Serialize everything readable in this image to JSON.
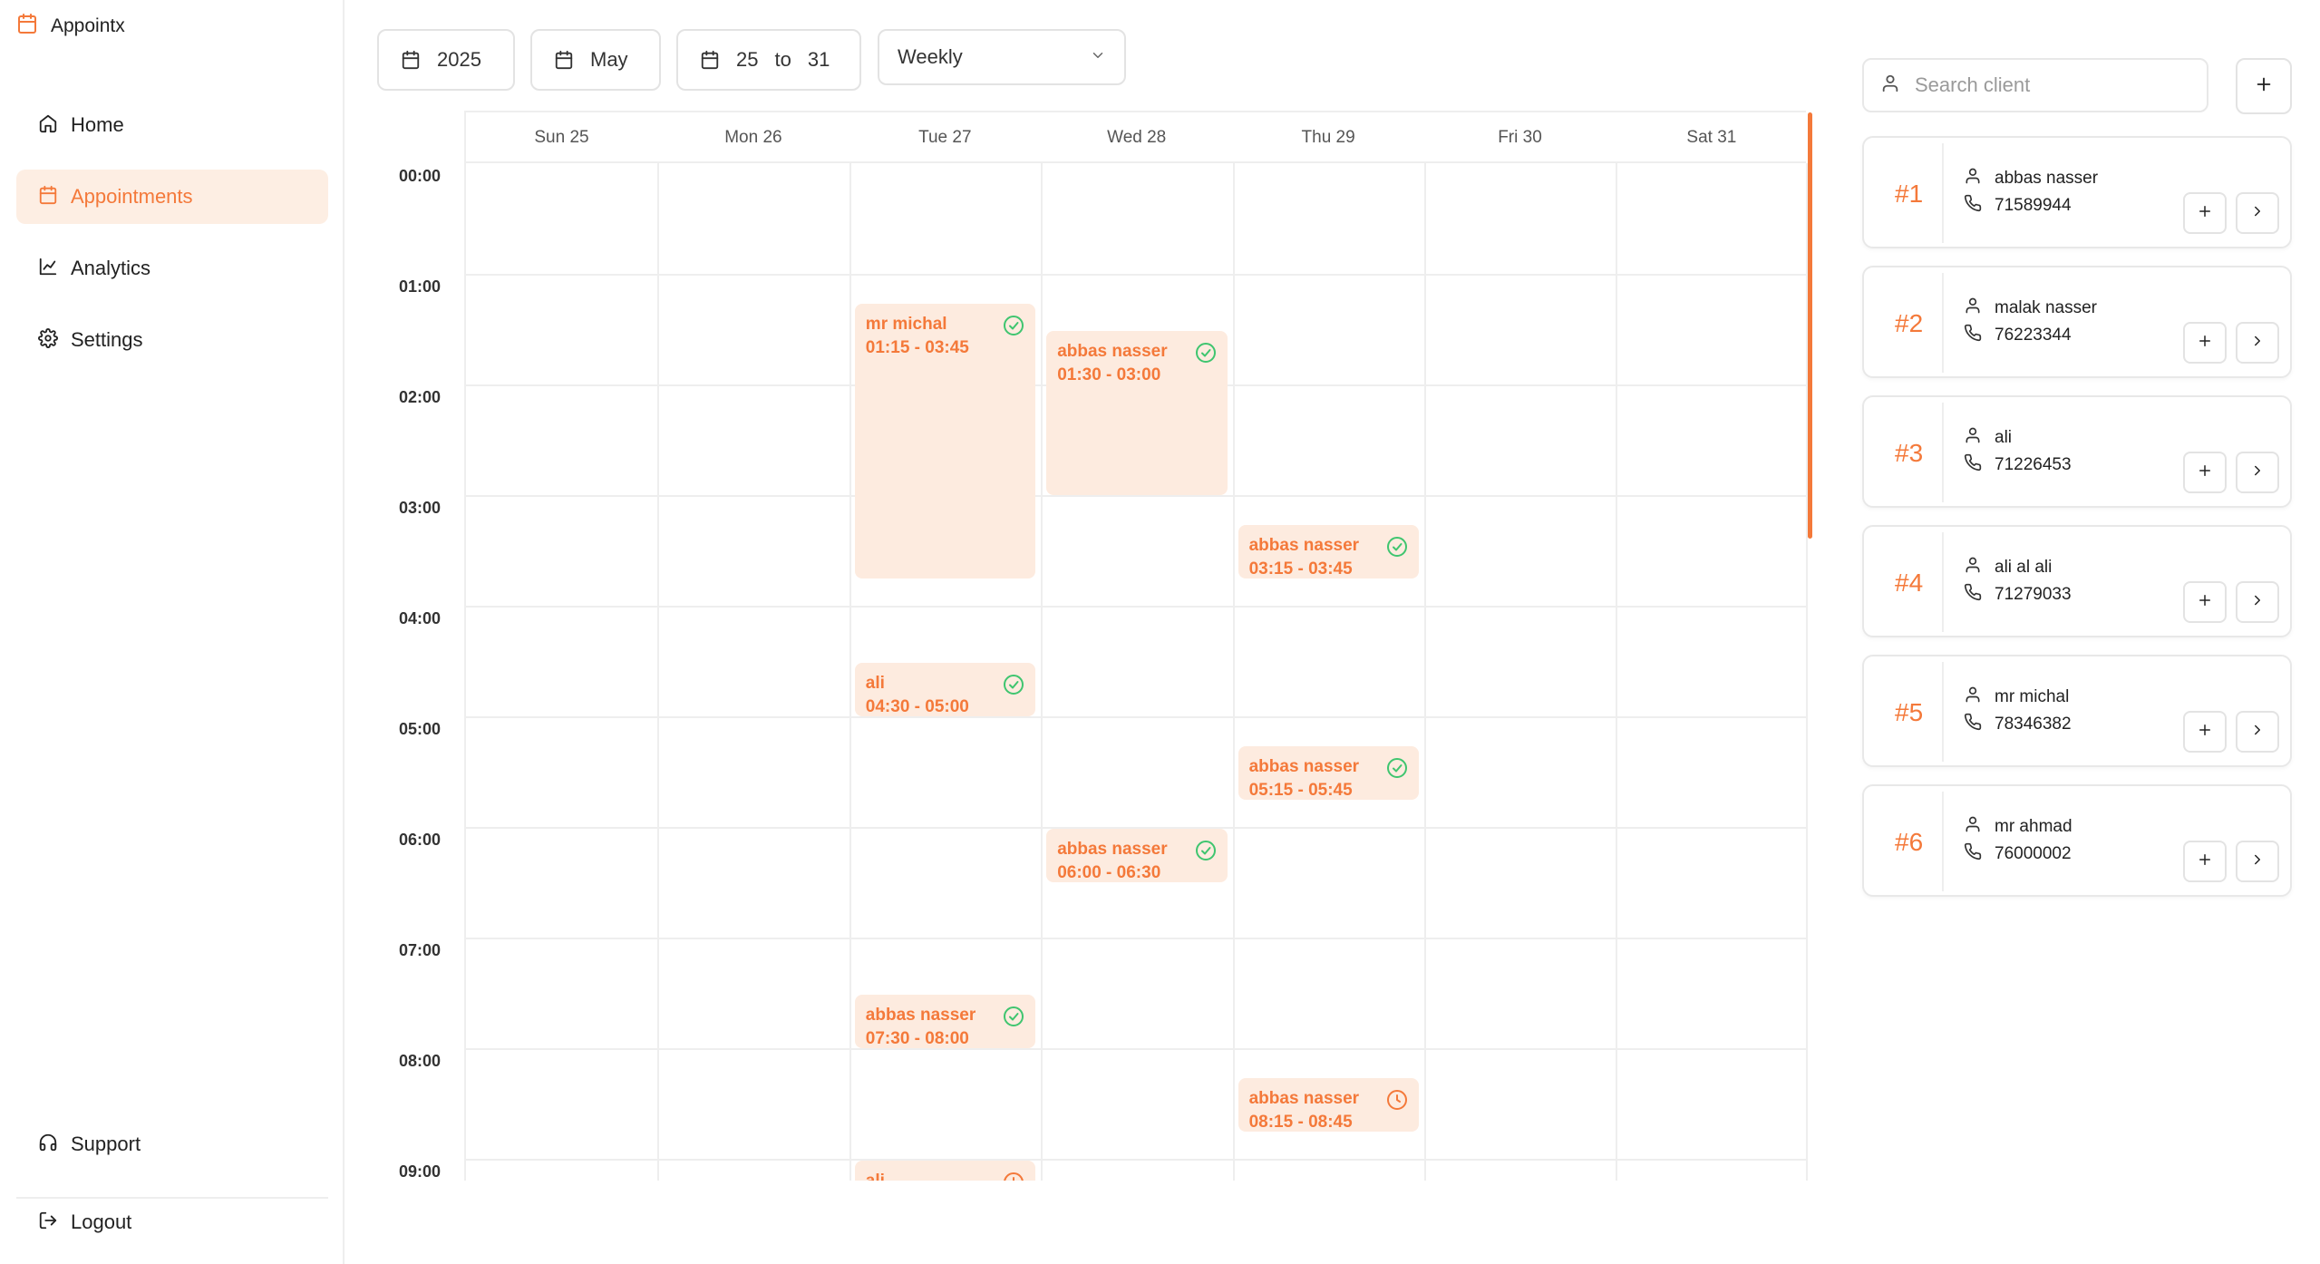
{
  "app": {
    "name": "Appointx"
  },
  "nav": {
    "home": "Home",
    "appointments": "Appointments",
    "analytics": "Analytics",
    "settings": "Settings",
    "support": "Support",
    "logout": "Logout"
  },
  "controls": {
    "year": "2025",
    "month": "May",
    "range_start": "25",
    "range_to": "to",
    "range_end": "31",
    "view": "Weekly"
  },
  "calendar": {
    "days": [
      "Sun 25",
      "Mon 26",
      "Tue 27",
      "Wed 28",
      "Thu 29",
      "Fri 30",
      "Sat 31"
    ],
    "hours": [
      "00:00",
      "01:00",
      "02:00",
      "03:00",
      "04:00",
      "05:00",
      "06:00",
      "07:00",
      "08:00",
      "09:00"
    ],
    "appointments": [
      {
        "day": 2,
        "name": "mr michal",
        "time": "01:15 - 03:45",
        "start": 1.25,
        "end": 3.75,
        "status": "done"
      },
      {
        "day": 3,
        "name": "abbas nasser",
        "time": "01:30 - 03:00",
        "start": 1.5,
        "end": 3.0,
        "status": "done"
      },
      {
        "day": 4,
        "name": "abbas nasser",
        "time": "03:15 - 03:45",
        "start": 3.25,
        "end": 3.75,
        "status": "done"
      },
      {
        "day": 2,
        "name": "ali",
        "time": "04:30 - 05:00",
        "start": 4.5,
        "end": 5.0,
        "status": "done"
      },
      {
        "day": 4,
        "name": "abbas nasser",
        "time": "05:15 - 05:45",
        "start": 5.25,
        "end": 5.75,
        "status": "done"
      },
      {
        "day": 3,
        "name": "abbas nasser",
        "time": "06:00 - 06:30",
        "start": 6.0,
        "end": 6.5,
        "status": "done"
      },
      {
        "day": 2,
        "name": "abbas nasser",
        "time": "07:30 - 08:00",
        "start": 7.5,
        "end": 8.0,
        "status": "done"
      },
      {
        "day": 4,
        "name": "abbas nasser",
        "time": "08:15 - 08:45",
        "start": 8.25,
        "end": 8.75,
        "status": "pending"
      },
      {
        "day": 2,
        "name": "ali",
        "time": "",
        "start": 9.0,
        "end": 9.5,
        "status": "pending"
      }
    ]
  },
  "search": {
    "placeholder": "Search client"
  },
  "clients": [
    {
      "num": "#1",
      "name": "abbas nasser",
      "phone": "71589944"
    },
    {
      "num": "#2",
      "name": "malak nasser",
      "phone": "76223344"
    },
    {
      "num": "#3",
      "name": "ali",
      "phone": "71226453"
    },
    {
      "num": "#4",
      "name": "ali al ali",
      "phone": "71279033"
    },
    {
      "num": "#5",
      "name": "mr michal",
      "phone": "78346382"
    },
    {
      "num": "#6",
      "name": "mr ahmad",
      "phone": "76000002"
    }
  ],
  "colors": {
    "accent": "#f4793a",
    "accent_bg": "#fdebdf",
    "done": "#3fc56f",
    "pending": "#f4793a"
  },
  "icons": {
    "status_done": "check-circle-icon",
    "status_pending": "clock-icon"
  }
}
